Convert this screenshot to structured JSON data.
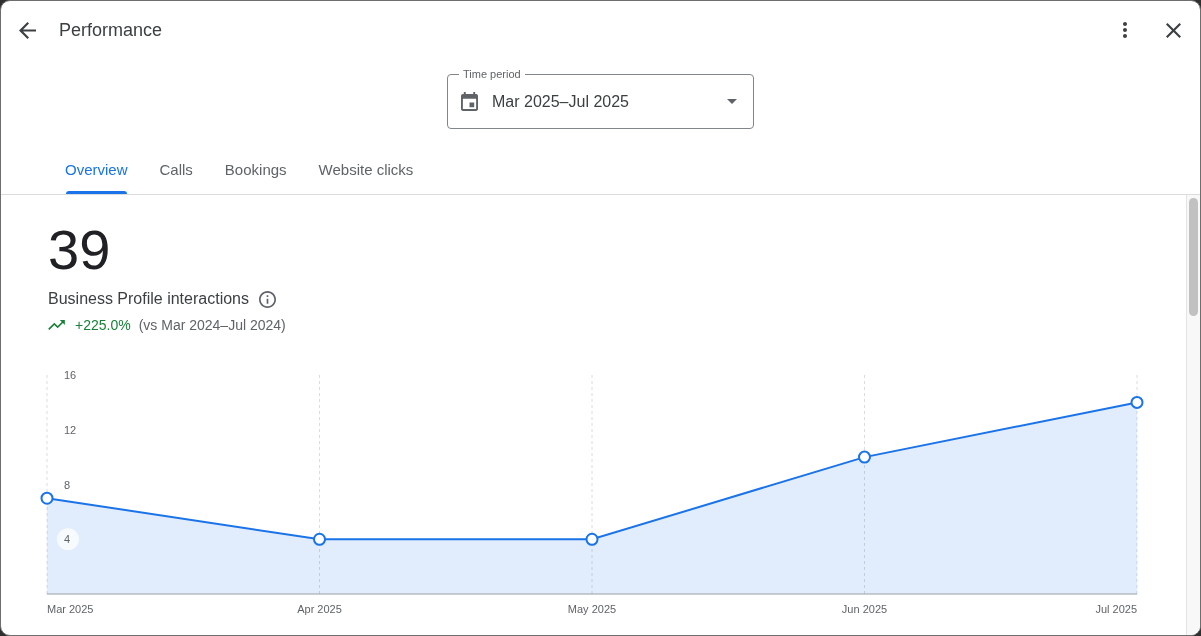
{
  "header": {
    "title": "Performance"
  },
  "time_period": {
    "label": "Time period",
    "value": "Mar 2025–Jul 2025"
  },
  "tabs": [
    {
      "label": "Overview",
      "selected": true
    },
    {
      "label": "Calls",
      "selected": false
    },
    {
      "label": "Bookings",
      "selected": false
    },
    {
      "label": "Website clicks",
      "selected": false
    }
  ],
  "summary": {
    "total": "39",
    "metric": "Business Profile interactions",
    "change": "+225.0%",
    "comparison": "(vs Mar 2024–Jul 2024)"
  },
  "chart": {
    "chart_data": {
      "type": "area",
      "categories": [
        "Mar 2025",
        "Apr 2025",
        "May 2025",
        "Jun 2025",
        "Jul 2025"
      ],
      "series": [
        {
          "color": "#1a73e8",
          "values": [
            7,
            4,
            4,
            10,
            14
          ]
        }
      ],
      "ylim": [
        0,
        16
      ],
      "yticks": [
        4,
        8,
        12,
        16
      ],
      "grid": true
    }
  }
}
